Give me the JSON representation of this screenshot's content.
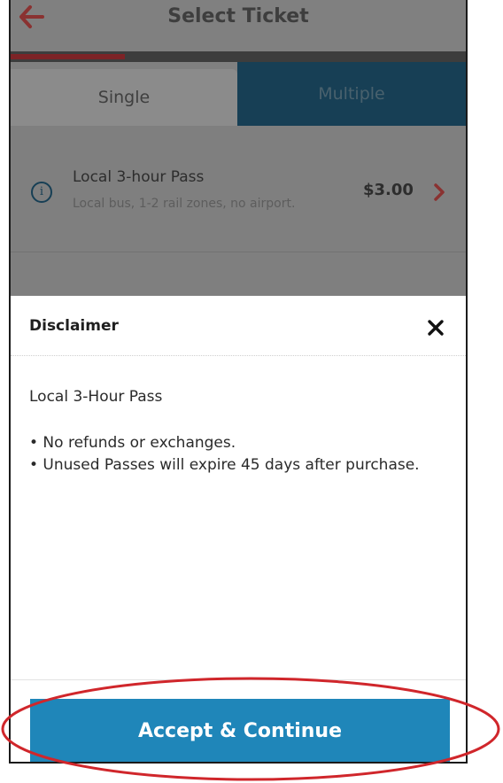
{
  "header": {
    "title": "Select Ticket",
    "back_icon": "arrow-left-icon"
  },
  "progress": {
    "fraction": 0.25,
    "color": "#7d2326"
  },
  "tabs": [
    {
      "label": "Single",
      "active": true
    },
    {
      "label": "Multiple",
      "active": false
    }
  ],
  "ticket": {
    "name": "Local 3-hour Pass",
    "description": "Local bus, 1-2 rail zones, no airport.",
    "price": "$3.00",
    "info_icon": "info-icon",
    "chevron_icon": "chevron-right-icon"
  },
  "modal": {
    "title": "Disclaimer",
    "close_icon": "close-icon",
    "pass_name": "Local 3-Hour Pass",
    "bullets": [
      "• No refunds or exchanges.",
      "• Unused Passes will expire 45 days after purchase."
    ],
    "accept_label": "Accept & Continue"
  },
  "colors": {
    "accent": "#1f86b9",
    "highlight_ring": "#d0262b",
    "brand_red": "#b5312b"
  }
}
